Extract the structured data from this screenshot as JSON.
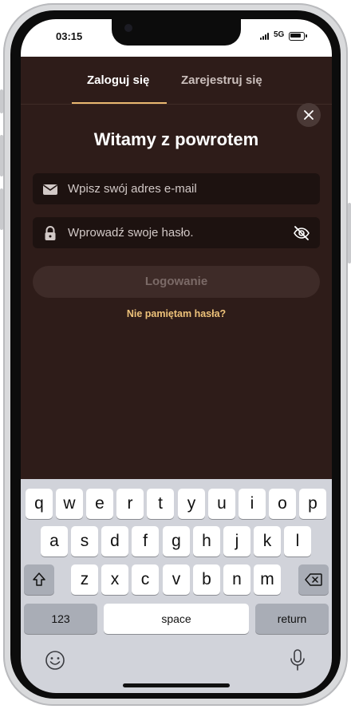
{
  "status_bar": {
    "time": "03:15",
    "network": "5G"
  },
  "tabs": [
    {
      "label": "Zaloguj się",
      "active": true
    },
    {
      "label": "Zarejestruj się",
      "active": false
    }
  ],
  "form": {
    "title": "Witamy z powrotem",
    "email_placeholder": "Wpisz swój adres e-mail",
    "password_placeholder": "Wprowadź swoje hasło.",
    "login_label": "Logowanie",
    "forgot_label": "Nie pamiętam hasła?"
  },
  "keyboard": {
    "row1": [
      "q",
      "w",
      "e",
      "r",
      "t",
      "y",
      "u",
      "i",
      "o",
      "p"
    ],
    "row2": [
      "a",
      "s",
      "d",
      "f",
      "g",
      "h",
      "j",
      "k",
      "l"
    ],
    "row3": [
      "z",
      "x",
      "c",
      "v",
      "b",
      "n",
      "m"
    ],
    "numbers_label": "123",
    "space_label": "space",
    "return_label": "return"
  },
  "icons": {
    "close": "close-icon",
    "email": "envelope-icon",
    "password": "lock-icon",
    "visibility": "eye-off-icon",
    "shift": "shift-icon",
    "backspace": "backspace-icon",
    "emoji": "emoji-icon",
    "mic": "microphone-icon"
  },
  "colors": {
    "background": "#2e1c19",
    "accent": "#e9b870",
    "link": "#eec27a",
    "input_bg": "#1d1210"
  }
}
